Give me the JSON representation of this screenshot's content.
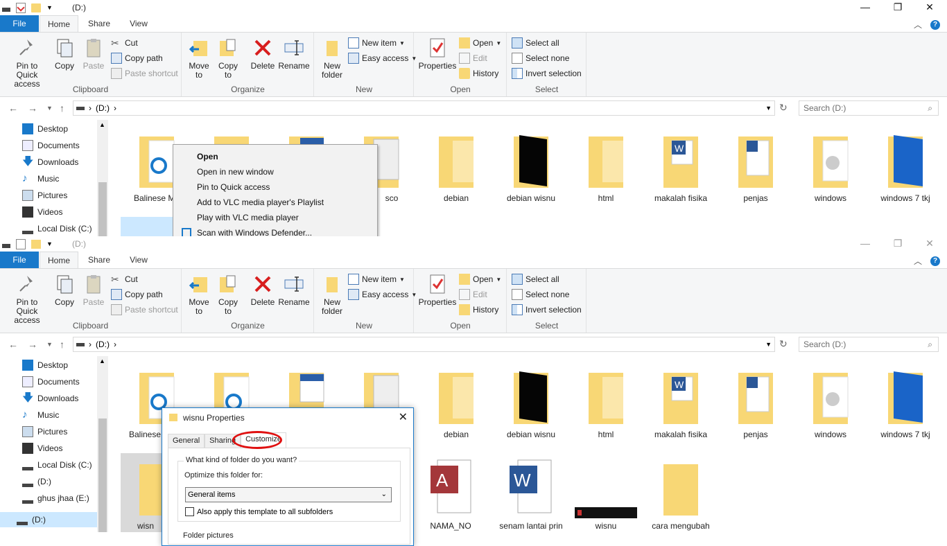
{
  "window": {
    "title": "(D:)",
    "tabs": {
      "file": "File",
      "home": "Home",
      "share": "Share",
      "view": "View"
    }
  },
  "ribbon": {
    "clipboard": {
      "label": "Clipboard",
      "pin": "Pin to Quick access",
      "copy": "Copy",
      "paste": "Paste",
      "cut": "Cut",
      "copy_path": "Copy path",
      "paste_shortcut": "Paste shortcut"
    },
    "organize": {
      "label": "Organize",
      "move_to": "Move to",
      "copy_to": "Copy to",
      "delete": "Delete",
      "rename": "Rename"
    },
    "new": {
      "label": "New",
      "new_folder": "New folder",
      "new_item": "New item",
      "easy_access": "Easy access"
    },
    "open": {
      "label": "Open",
      "properties": "Properties",
      "open": "Open",
      "edit": "Edit",
      "history": "History"
    },
    "select": {
      "label": "Select",
      "select_all": "Select all",
      "select_none": "Select none",
      "invert": "Invert selection"
    }
  },
  "address": {
    "path": "(D:)",
    "search_placeholder": "Search  (D:)"
  },
  "nav": {
    "desktop": "Desktop",
    "documents": "Documents",
    "downloads": "Downloads",
    "music": "Music",
    "pictures": "Pictures",
    "videos": "Videos",
    "local_disk": "Local Disk (C:)",
    "d_drive": "(D:)",
    "e_drive": "ghus jhaa (E:)",
    "d_drive_root": "(D:)"
  },
  "files_top": {
    "f1": "Balinese Mu",
    "f4": "sco",
    "f5": "debian",
    "f6": "debian wisnu",
    "f7": "html",
    "f8": "makalah fisika",
    "f9": "penjas",
    "f10": "windows",
    "f11": "windows 7 tkj"
  },
  "files_bottom": {
    "f1": "Balinese",
    "f5": "debian",
    "f6": "debian wisnu",
    "f7": "html",
    "f8": "makalah fisika",
    "f9": "penjas",
    "f10": "windows",
    "f11": "windows 7 tkj",
    "r1": "wisn",
    "r2": "NAMA_NO",
    "r3": "senam lantai prin",
    "r4": "wisnu",
    "r5": "cara mengubah"
  },
  "context_menu": {
    "open": "Open",
    "open_new": "Open in new window",
    "pin": "Pin to Quick access",
    "vlc_playlist": "Add to VLC media player's Playlist",
    "vlc_play": "Play with VLC media player",
    "defender": "Scan with Windows Defender..."
  },
  "dialog": {
    "title": "wisnu Properties",
    "tabs": {
      "general": "General",
      "sharing": "Sharing",
      "customize": "Customize"
    },
    "legend": "What kind of folder do you want?",
    "optimize_label": "Optimize this folder for:",
    "optimize_value": "General items",
    "apply_sub": "Also apply this template to all subfolders",
    "folder_pictures": "Folder pictures"
  },
  "colors": {
    "accent": "#1979ca",
    "folder": "#f8d775",
    "highlight": "#e01010"
  }
}
